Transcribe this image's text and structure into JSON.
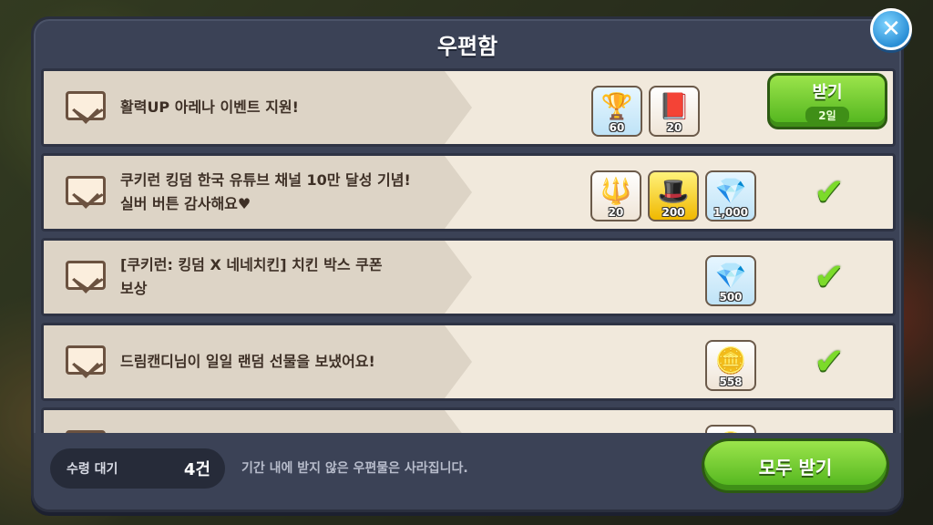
{
  "dialog": {
    "title": "우편함"
  },
  "mails": [
    {
      "message": "활력UP 아레나 이벤트 지원!",
      "rewards": [
        {
          "icon": "trophy-icon",
          "glyph": "🏆",
          "style": "blue",
          "qty": "60"
        },
        {
          "icon": "ticket-book-icon",
          "glyph": "📕",
          "style": "red",
          "qty": "20"
        }
      ],
      "action": "claim",
      "claim_label": "받기",
      "claim_sub": "2일"
    },
    {
      "message": "쿠키런 킹덤 한국 유튜브 채널 10만 달성 기념!\n실버 버튼 감사해요♥",
      "rewards": [
        {
          "icon": "red-crystal-icon",
          "glyph": "🔱",
          "style": "red",
          "qty": "20"
        },
        {
          "icon": "wizard-hat-icon",
          "glyph": "🎩",
          "style": "gold",
          "qty": "200"
        },
        {
          "icon": "crystal-icon",
          "glyph": "💎",
          "style": "blue",
          "qty": "1,000"
        }
      ],
      "action": "claimed"
    },
    {
      "message": "[쿠키런: 킹덤 X 네네치킨] 치킨 박스 쿠폰\n보상",
      "rewards": [
        {
          "icon": "crystal-icon",
          "glyph": "💎",
          "style": "blue",
          "qty": "500"
        }
      ],
      "action": "claimed"
    },
    {
      "message": "드림캔디님이 일일 랜덤 선물을 보냈어요!",
      "rewards": [
        {
          "icon": "coin-icon",
          "glyph": "🪙",
          "style": "red",
          "qty": "558"
        }
      ],
      "action": "claimed"
    },
    {
      "message": "",
      "rewards": [
        {
          "icon": "coin-icon",
          "glyph": "🪙",
          "style": "red",
          "qty": ""
        }
      ],
      "action": "claimed"
    }
  ],
  "footer": {
    "pending_label": "수령 대기",
    "pending_count": "4건",
    "notice": "기간 내에 받지 않은 우편물은 사라집니다.",
    "claim_all_label": "모두 받기"
  },
  "colors": {
    "dialog_bg": "#3b4256",
    "row_bg": "#f1e9dc",
    "button_green": "#4fb31c",
    "close_blue": "#2b8fd6"
  }
}
